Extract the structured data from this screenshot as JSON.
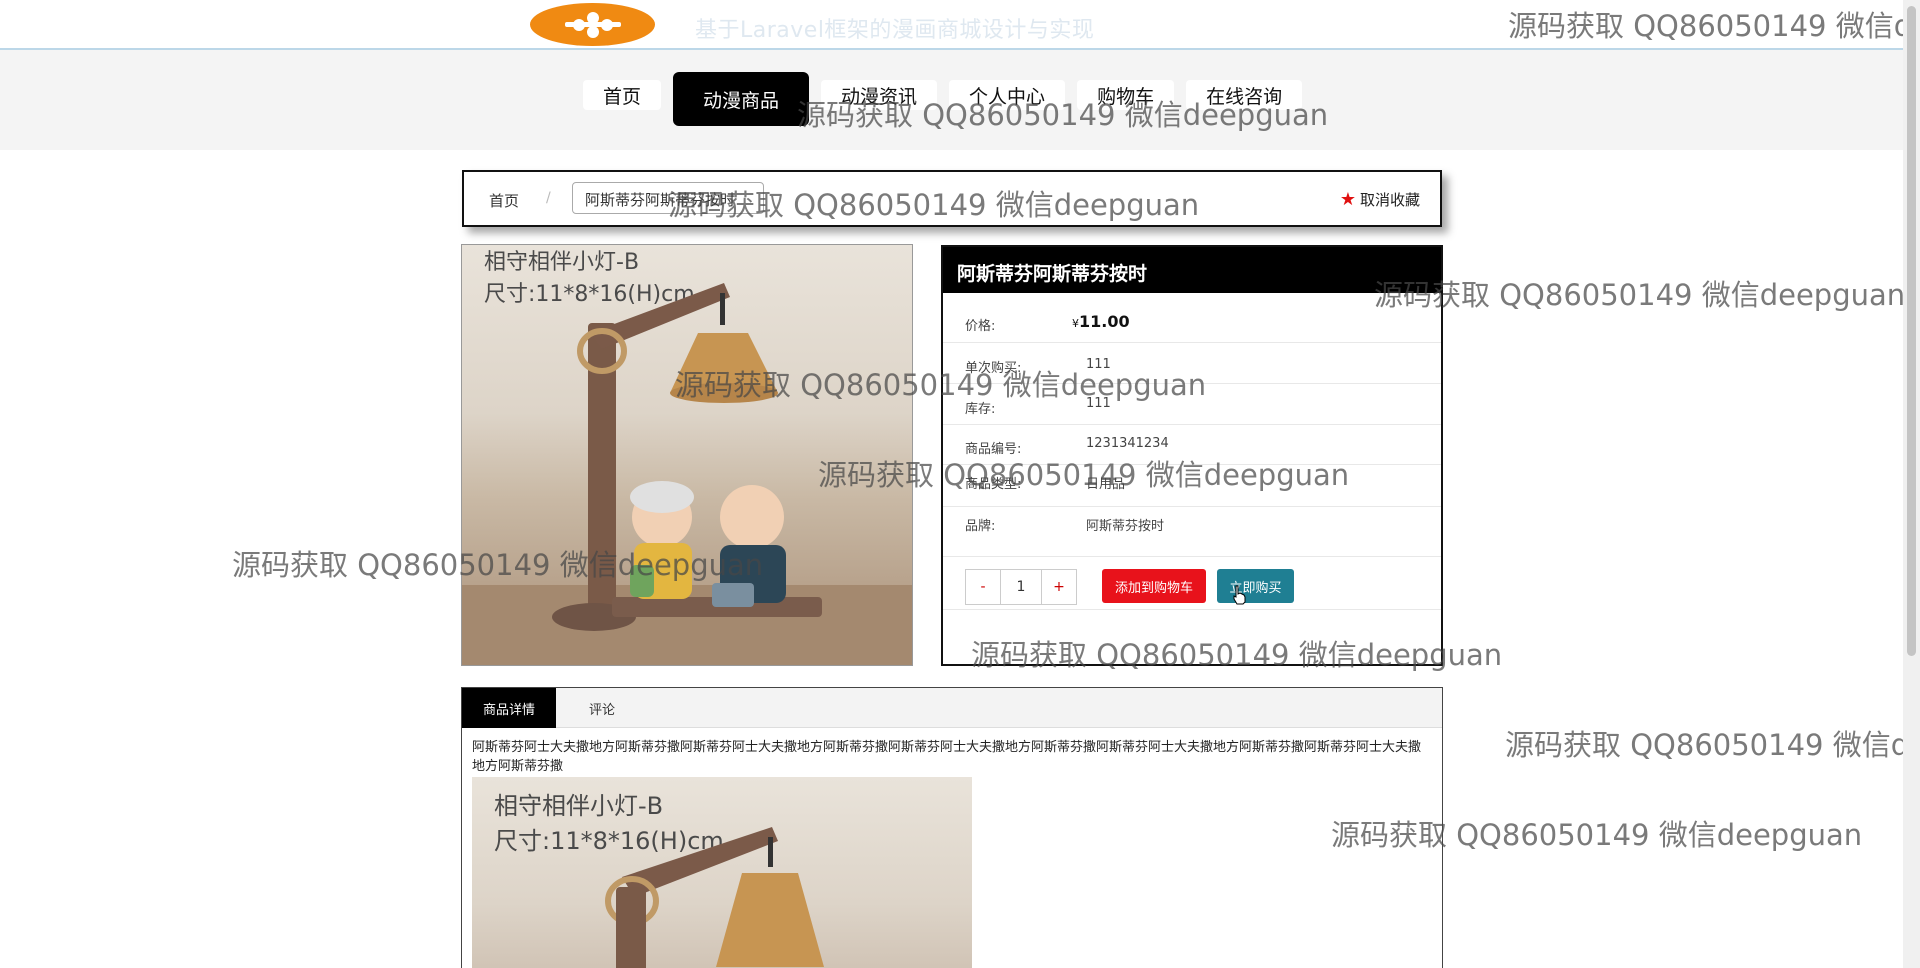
{
  "header": {
    "site_title": "基于Laravel框架的漫画商城设计与实现"
  },
  "nav": {
    "items": [
      "首页",
      "动漫商品",
      "动漫资讯",
      "个人中心",
      "购物车",
      "在线咨询"
    ],
    "active_index": 1
  },
  "breadcrumb": {
    "home": "首页",
    "separator": "/",
    "current": "阿斯蒂芬阿斯蒂芬按时",
    "favorite_label": "取消收藏",
    "favorite_icon": "star-icon"
  },
  "product_image": {
    "caption_line1": "相守相伴小灯-B",
    "caption_line2": "尺寸:11*8*16(H)cm"
  },
  "product": {
    "title": "阿斯蒂芬阿斯蒂芬按时",
    "price_label": "价格:",
    "price_symbol": "¥",
    "price_value": "11.00",
    "limit_label": "单次购买:",
    "limit_value": "111",
    "stock_label": "库存:",
    "stock_value": "111",
    "code_label": "商品编号:",
    "code_value": "1231341234",
    "type_label": "商品类型:",
    "type_value": "日用品",
    "brand_label": "品牌:",
    "brand_value": "阿斯蒂芬按时",
    "qty_minus": "-",
    "qty_value": "1",
    "qty_plus": "+",
    "add_cart_label": "添加到购物车",
    "buy_now_label": "立即购买"
  },
  "detail": {
    "tabs": [
      "商品详情",
      "评论"
    ],
    "text": "阿斯蒂芬阿士大夫撒地方阿斯蒂芬撒阿斯蒂芬阿士大夫撒地方阿斯蒂芬撒阿斯蒂芬阿士大夫撒地方阿斯蒂芬撒阿斯蒂芬阿士大夫撒地方阿斯蒂芬撒阿斯蒂芬阿士大夫撒地方阿斯蒂芬撒",
    "image_caption_line1": "相守相伴小灯-B",
    "image_caption_line2": "尺寸:11*8*16(H)cm"
  },
  "watermark": {
    "text": "源码获取 QQ86050149 微信deepguan",
    "short": "源码获取 QQ86050149 微信d",
    "short2": "源码获取 QQ86050149 微信de"
  },
  "colors": {
    "accent_red": "#e8121b",
    "accent_teal": "#1f7f93",
    "logo_orange": "#f08a12"
  }
}
